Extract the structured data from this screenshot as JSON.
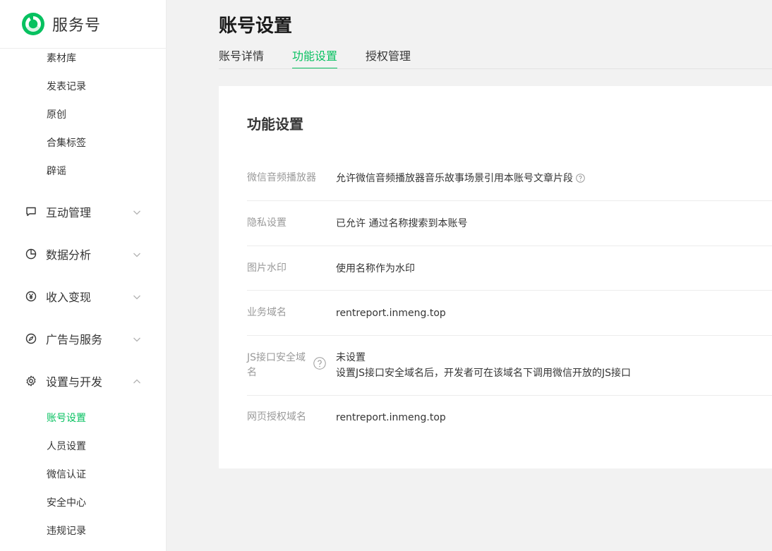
{
  "brand": {
    "name": "服务号",
    "accent": "#07c160"
  },
  "sidebar": {
    "top_items": [
      "素材库",
      "发表记录",
      "原创",
      "合集标签",
      "辟谣"
    ],
    "groups": [
      {
        "label": "互动管理",
        "icon": "chat-bubble-icon",
        "expanded": false
      },
      {
        "label": "数据分析",
        "icon": "pie-chart-icon",
        "expanded": false
      },
      {
        "label": "收入变现",
        "icon": "yen-coin-icon",
        "expanded": false
      },
      {
        "label": "广告与服务",
        "icon": "compass-icon",
        "expanded": false
      },
      {
        "label": "设置与开发",
        "icon": "gear-icon",
        "expanded": true
      }
    ],
    "settings_items": [
      {
        "label": "账号设置",
        "active": true
      },
      {
        "label": "人员设置",
        "active": false
      },
      {
        "label": "微信认证",
        "active": false
      },
      {
        "label": "安全中心",
        "active": false
      },
      {
        "label": "违规记录",
        "active": false
      }
    ]
  },
  "page": {
    "title": "账号设置",
    "tabs": [
      {
        "label": "账号详情",
        "active": false
      },
      {
        "label": "功能设置",
        "active": true
      },
      {
        "label": "授权管理",
        "active": false
      }
    ]
  },
  "card": {
    "title": "功能设置",
    "rows": [
      {
        "label": "微信音频播放器",
        "value": "允许微信音频播放器音乐故事场景引用本账号文章片段"
      },
      {
        "label": "隐私设置",
        "value": "已允许 通过名称搜索到本账号"
      },
      {
        "label": "图片水印",
        "value": "使用名称作为水印"
      },
      {
        "label": "业务域名",
        "value": "rentreport.inmeng.top"
      },
      {
        "label_line1": "JS接口安全域",
        "label_line2": "名",
        "value_line1": "未设置",
        "value_line2": "设置JS接口安全域名后，开发者可在该域名下调用微信开放的JS接口"
      },
      {
        "label": "网页授权域名",
        "value": "rentreport.inmeng.top"
      }
    ]
  }
}
